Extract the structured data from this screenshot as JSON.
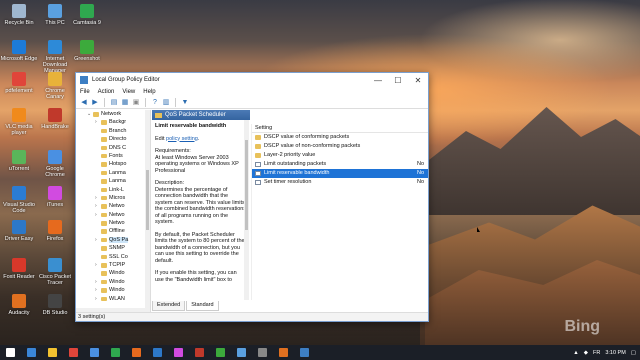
{
  "desktop_icons": [
    {
      "label": "Recycle Bin",
      "color": "#9fb7d0"
    },
    {
      "label": "This PC",
      "color": "#5aa0e0"
    },
    {
      "label": "Camtasia 9",
      "color": "#2fa84f"
    },
    {
      "label": "Microsoft Edge",
      "color": "#1d7bd8"
    },
    {
      "label": "Internet Download Manager",
      "color": "#2d8ad8"
    },
    {
      "label": "Greenshot",
      "color": "#3caa3c"
    },
    {
      "label": "pdfelement",
      "color": "#e0453a"
    },
    {
      "label": "Chrome Canary",
      "color": "#e8b23a"
    },
    {
      "label": "VLC media player",
      "color": "#f08a1c"
    },
    {
      "label": "HandBrake",
      "color": "#c0392b"
    },
    {
      "label": "uTorrent",
      "color": "#5ab55a"
    },
    {
      "label": "Google Chrome",
      "color": "#4a90e2"
    },
    {
      "label": "Visual Studio Code",
      "color": "#2b7cd3"
    },
    {
      "label": "iTunes",
      "color": "#d14be0"
    },
    {
      "label": "Driver Easy",
      "color": "#2d78c8"
    },
    {
      "label": "Firefox",
      "color": "#e66a1e"
    },
    {
      "label": "Foxit Reader",
      "color": "#d8382a"
    },
    {
      "label": "Cisco Packet Tracer",
      "color": "#3a8fd0"
    },
    {
      "label": "Audacity",
      "color": "#e07020"
    },
    {
      "label": "DB Studio",
      "color": "#444"
    }
  ],
  "window": {
    "title": "Local Group Policy Editor",
    "controls": {
      "minimize": "—",
      "maximize": "☐",
      "close": "✕"
    },
    "menu": [
      "File",
      "Action",
      "View",
      "Help"
    ],
    "tree": {
      "root": "Network",
      "items": [
        {
          "label": "Backgr",
          "expandable": true
        },
        {
          "label": "Branch",
          "expandable": false
        },
        {
          "label": "Directo",
          "expandable": false
        },
        {
          "label": "DNS C",
          "expandable": false
        },
        {
          "label": "Fonts",
          "expandable": false
        },
        {
          "label": "Hotspo",
          "expandable": false
        },
        {
          "label": "Lanma",
          "expandable": false
        },
        {
          "label": "Lanma",
          "expandable": false
        },
        {
          "label": "Link-L",
          "expandable": false
        },
        {
          "label": "Micros",
          "expandable": true
        },
        {
          "label": "Netwo",
          "expandable": true
        },
        {
          "label": "Netwo",
          "expandable": true
        },
        {
          "label": "Netwo",
          "expandable": false
        },
        {
          "label": "Offline",
          "expandable": false
        },
        {
          "label": "QoS Pa",
          "expandable": true,
          "selected": true
        },
        {
          "label": "SNMP",
          "expandable": false
        },
        {
          "label": "SSL Co",
          "expandable": false
        },
        {
          "label": "TCPIP",
          "expandable": true
        },
        {
          "label": "Windo",
          "expandable": false
        },
        {
          "label": "Windo",
          "expandable": true
        },
        {
          "label": "Windo",
          "expandable": true
        },
        {
          "label": "WLAN",
          "expandable": true
        }
      ]
    },
    "header": "QoS Packet Scheduler",
    "description": {
      "title": "Limit reservable bandwidth",
      "edit_prefix": "Edit ",
      "edit_link": "policy setting",
      "edit_suffix": ".",
      "req_label": "Requirements:",
      "req_text": "At least Windows Server 2003 operating systems or Windows XP Professional",
      "desc_label": "Description:",
      "desc_text": "Determines the percentage of connection bandwidth that the system can reserve. This value limits the combined bandwidth reservations of all programs running on the system.",
      "para2": "By default, the Packet Scheduler limits the system to 80 percent of the bandwidth of a connection, but you can use this setting to override the default.",
      "para3": "If you enable this setting, you can use the \"Bandwidth limit\" box to"
    },
    "settings": {
      "column": "Setting",
      "rows": [
        {
          "label": "DSCP value of conforming packets",
          "kind": "folder",
          "state": ""
        },
        {
          "label": "DSCP value of non-conforming packets",
          "kind": "folder",
          "state": ""
        },
        {
          "label": "Layer-2 priority value",
          "kind": "folder",
          "state": ""
        },
        {
          "label": "Limit outstanding packets",
          "kind": "policy",
          "state": "No"
        },
        {
          "label": "Limit reservable bandwidth",
          "kind": "policy",
          "state": "No",
          "selected": true
        },
        {
          "label": "Set timer resolution",
          "kind": "policy",
          "state": "No"
        }
      ]
    },
    "tabs": [
      "Extended",
      "Standard"
    ],
    "status": "3 setting(s)"
  },
  "taskbar": {
    "language": "FR",
    "time": "3:10 PM"
  },
  "watermark": "Bing"
}
